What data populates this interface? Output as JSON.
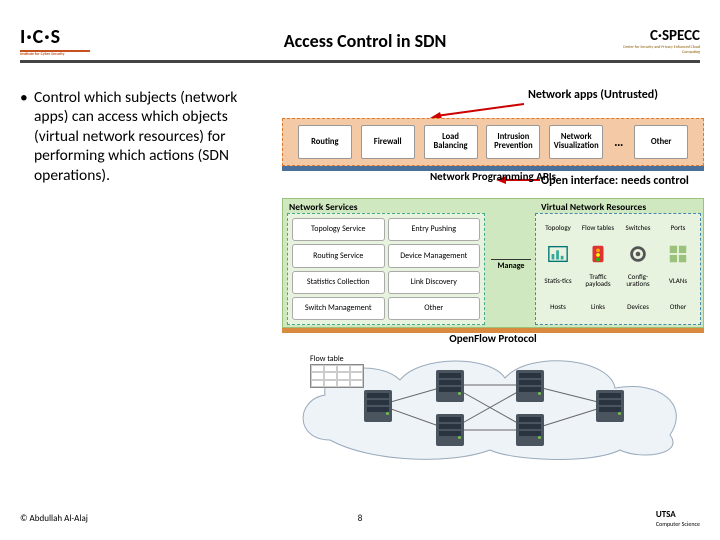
{
  "header": {
    "logo_left": {
      "main": "I·C·S",
      "sub": "Institute for Cyber Security"
    },
    "title": "Access Control in SDN",
    "logo_right": {
      "main": "C·SPECC",
      "sub": "Center for Security and Privacy Enhanced Cloud Computing"
    }
  },
  "bullet": "Control which subjects (network apps) can access which objects (virtual network resources) for performing which actions (SDN operations).",
  "annotations": {
    "untrusted": "Network apps (Untrusted)",
    "open_if": "Open interface: needs control"
  },
  "diagram": {
    "apps": [
      "Routing",
      "Firewall",
      "Load Balancing",
      "Intrusion Prevention",
      "Network Visualization",
      "Other"
    ],
    "apps_ellipsis": "…",
    "np_label": "Network Programming APIs",
    "ns_title": "Network Services",
    "ns_cells": [
      "Topology Service",
      "Entry Pushing",
      "Routing Service",
      "Device Management",
      "Statistics Collection",
      "Link Discovery",
      "Switch Management",
      "Other"
    ],
    "manage": "Manage",
    "vnr_title": "Virtual Network Resources",
    "vnr_row1": [
      "Topology",
      "Flow tables",
      "Switches",
      "Ports"
    ],
    "vnr_row2": [
      "Statis-tics",
      "Traffic payloads",
      "Config-urations",
      "VLANs"
    ],
    "vnr_row3": [
      "Hosts",
      "Links",
      "Devices",
      "Other"
    ],
    "of_label": "OpenFlow Protocol",
    "flow_table": "Flow table"
  },
  "footer": {
    "left": "© Abdullah Al-Alaj",
    "page": "8",
    "utsa": "UTSA",
    "dept": "Computer Science"
  }
}
